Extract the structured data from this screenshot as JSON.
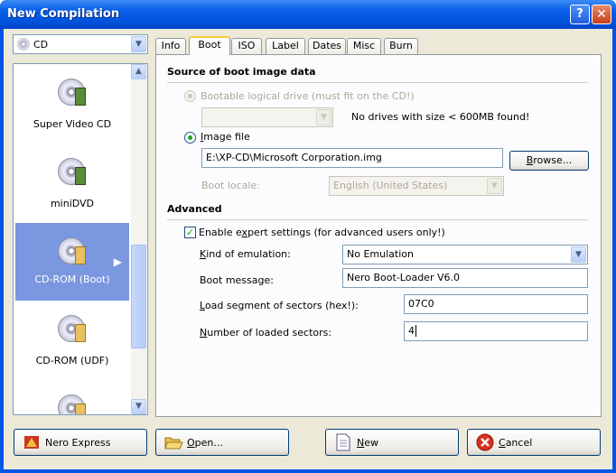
{
  "window": {
    "title": "New Compilation",
    "help_glyph": "?",
    "close_glyph": "✕"
  },
  "type_select": {
    "value": "CD",
    "icon": "cd-icon"
  },
  "compilation_types": [
    {
      "label": "Super Video CD",
      "icon": "super-video-cd-icon",
      "selected": false
    },
    {
      "label": "miniDVD",
      "icon": "minidvd-icon",
      "selected": false
    },
    {
      "label": "CD-ROM (Boot)",
      "icon": "cdrom-boot-icon",
      "selected": true
    },
    {
      "label": "CD-ROM (UDF)",
      "icon": "cdrom-udf-icon",
      "selected": false
    }
  ],
  "tabs": [
    "Info",
    "Boot",
    "ISO",
    "Label",
    "Dates",
    "Misc",
    "Burn"
  ],
  "active_tab": "Boot",
  "boot": {
    "source_heading": "Source of boot image data",
    "bootable_drive": {
      "label": "Bootable logical drive (must fit on the CD!)",
      "enabled": false,
      "selected": false
    },
    "drive_combo_value": "",
    "no_drives_msg": "No drives with size < 600MB found!",
    "image_file": {
      "label_prefix": "",
      "label_underlined": "I",
      "label_suffix": "mage file",
      "selected": true
    },
    "image_path": "E:\\XP-CD\\Microsoft Corporation.img",
    "browse_prefix": "",
    "browse_underlined": "B",
    "browse_suffix": "rowse...",
    "boot_locale_label": "Boot locale:",
    "boot_locale_value": "English (United States)",
    "advanced_heading": "Advanced",
    "expert": {
      "prefix": "Enable e",
      "underlined": "x",
      "suffix": "pert settings (for advanced users only!)",
      "checked": true
    },
    "emulation": {
      "prefix": "",
      "underlined": "K",
      "suffix": "ind of emulation:",
      "value": "No Emulation"
    },
    "boot_message": {
      "label": "Boot message:",
      "value": "Nero Boot-Loader V6.0"
    },
    "load_segment": {
      "prefix": "",
      "underlined": "L",
      "suffix": "oad segment of sectors (hex!):",
      "value": "07C0"
    },
    "loaded_sectors": {
      "prefix": "",
      "underlined": "N",
      "suffix": "umber of loaded sectors:",
      "value": "4"
    }
  },
  "buttons": {
    "nero_express": "Nero Express",
    "open": {
      "prefix": "",
      "underlined": "O",
      "suffix": "pen..."
    },
    "new": {
      "prefix": "",
      "underlined": "N",
      "suffix": "ew"
    },
    "cancel": {
      "prefix": "",
      "underlined": "C",
      "suffix": "ancel"
    }
  },
  "colors": {
    "title_bar": "#0055e5",
    "selection": "#7b97e0",
    "tab_highlight": "#ffc83c",
    "dialog_bg": "#ece9d8"
  }
}
